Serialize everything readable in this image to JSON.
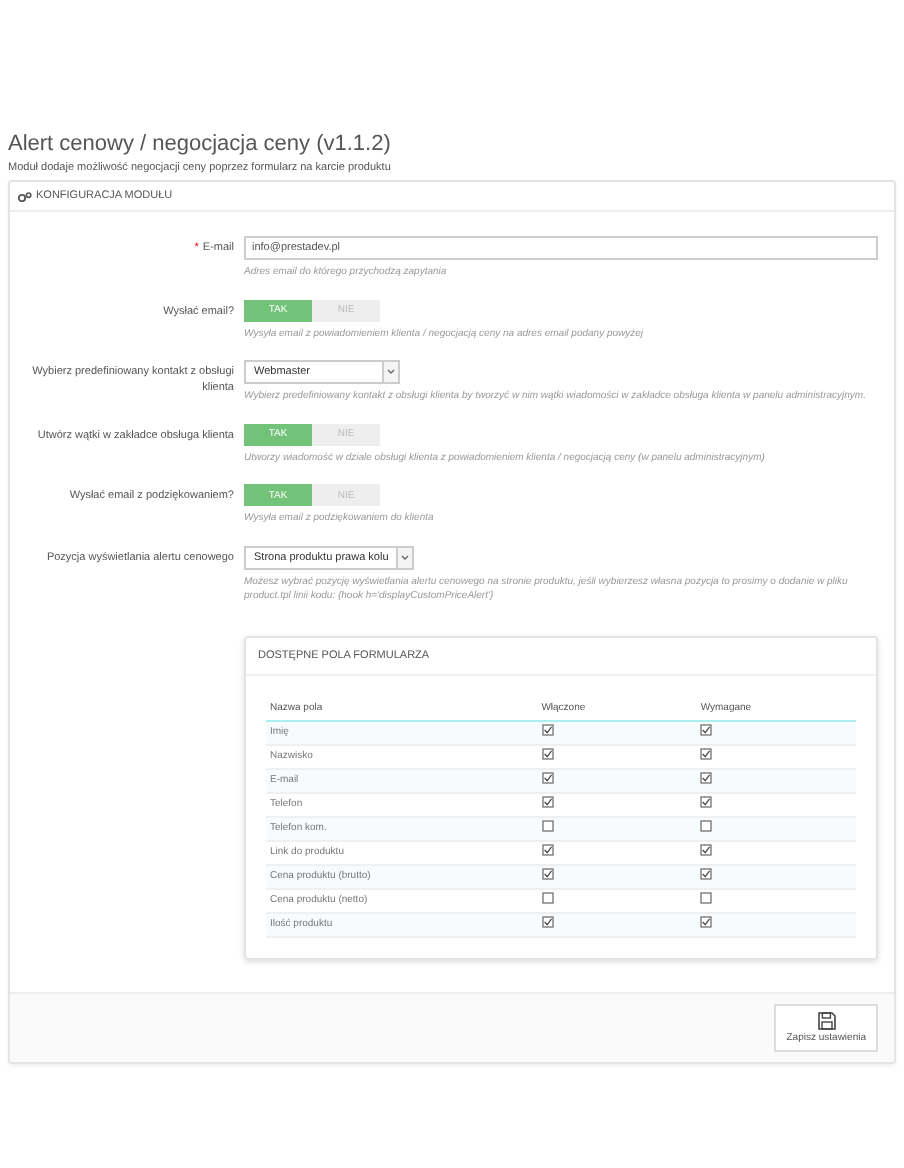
{
  "title": "Alert cenowy / negocjacja ceny (v1.1.2)",
  "description": "Moduł dodaje możliwość negocjacji ceny poprzez formularz na karcie produktu",
  "panel": {
    "heading": "KONFIGURACJA MODUŁU",
    "fields": [
      {
        "kind": "text",
        "required_mark": "*",
        "label": "E-mail",
        "value": "info@prestadev.pl",
        "hint": "Adres email do którego przychodzą zapytania"
      },
      {
        "kind": "toggle",
        "label": "Wysłać email?",
        "options": [
          {
            "label": "TAK",
            "selected": true
          },
          {
            "label": "NIE",
            "selected": false
          }
        ],
        "hint": "Wysyła email z powiadomieniem klienta / negocjacją ceny na adres email podany powyżej"
      },
      {
        "kind": "select",
        "label": "Wybierz predefiniowany kontakt z obsługi klienta",
        "value": "Webmaster",
        "hint": "Wybierz predefiniowany kontakt z obsługi klienta by tworzyć w nim wątki wiadomości w zakładce obsługa klienta w panelu administracyjnym."
      },
      {
        "kind": "toggle",
        "label": "Utwórz wątki w zakładce obsługa klienta",
        "options": [
          {
            "label": "TAK",
            "selected": true
          },
          {
            "label": "NIE",
            "selected": false
          }
        ],
        "hint": "Utworzy wiadomość w dziale obsługi klienta z powiadomieniem klienta / negocjacją ceny (w panelu administracyjnym)"
      },
      {
        "kind": "toggle",
        "label": "Wysłać email z podziękowaniem?",
        "options": [
          {
            "label": "TAK",
            "selected": true
          },
          {
            "label": "NIE",
            "selected": false
          }
        ],
        "hint": "Wysyła email z podziękowaniem do klienta"
      },
      {
        "kind": "select",
        "label": "Pozycja wyświetlania alertu cenowego",
        "value": "Strona produktu prawa kolu",
        "hint": "Możesz wybrać pozycję wyświetlania alertu cenowego na stronie produktu, jeśli wybierzesz własna pozycja to prosimy o dodanie w pliku product.tpl linii kodu: {hook h='displayCustomPriceAlert'}"
      }
    ],
    "fields_table": {
      "heading": "DOSTĘPNE POLA FORMULARZA",
      "columns": [
        "Nazwa pola",
        "Włączone",
        "Wymagane"
      ],
      "rows": [
        {
          "name": "Imię",
          "enabled": true,
          "required": true
        },
        {
          "name": "Nazwisko",
          "enabled": true,
          "required": true
        },
        {
          "name": "E-mail",
          "enabled": true,
          "required": true
        },
        {
          "name": "Telefon",
          "enabled": true,
          "required": true
        },
        {
          "name": "Telefon kom.",
          "enabled": false,
          "required": false
        },
        {
          "name": "Link do produktu",
          "enabled": true,
          "required": true
        },
        {
          "name": "Cena produktu (brutto)",
          "enabled": true,
          "required": true
        },
        {
          "name": "Cena produktu (netto)",
          "enabled": false,
          "required": false
        },
        {
          "name": "Ilość produktu",
          "enabled": true,
          "required": true
        }
      ]
    },
    "save_button": "Zapisz ustawienia"
  }
}
